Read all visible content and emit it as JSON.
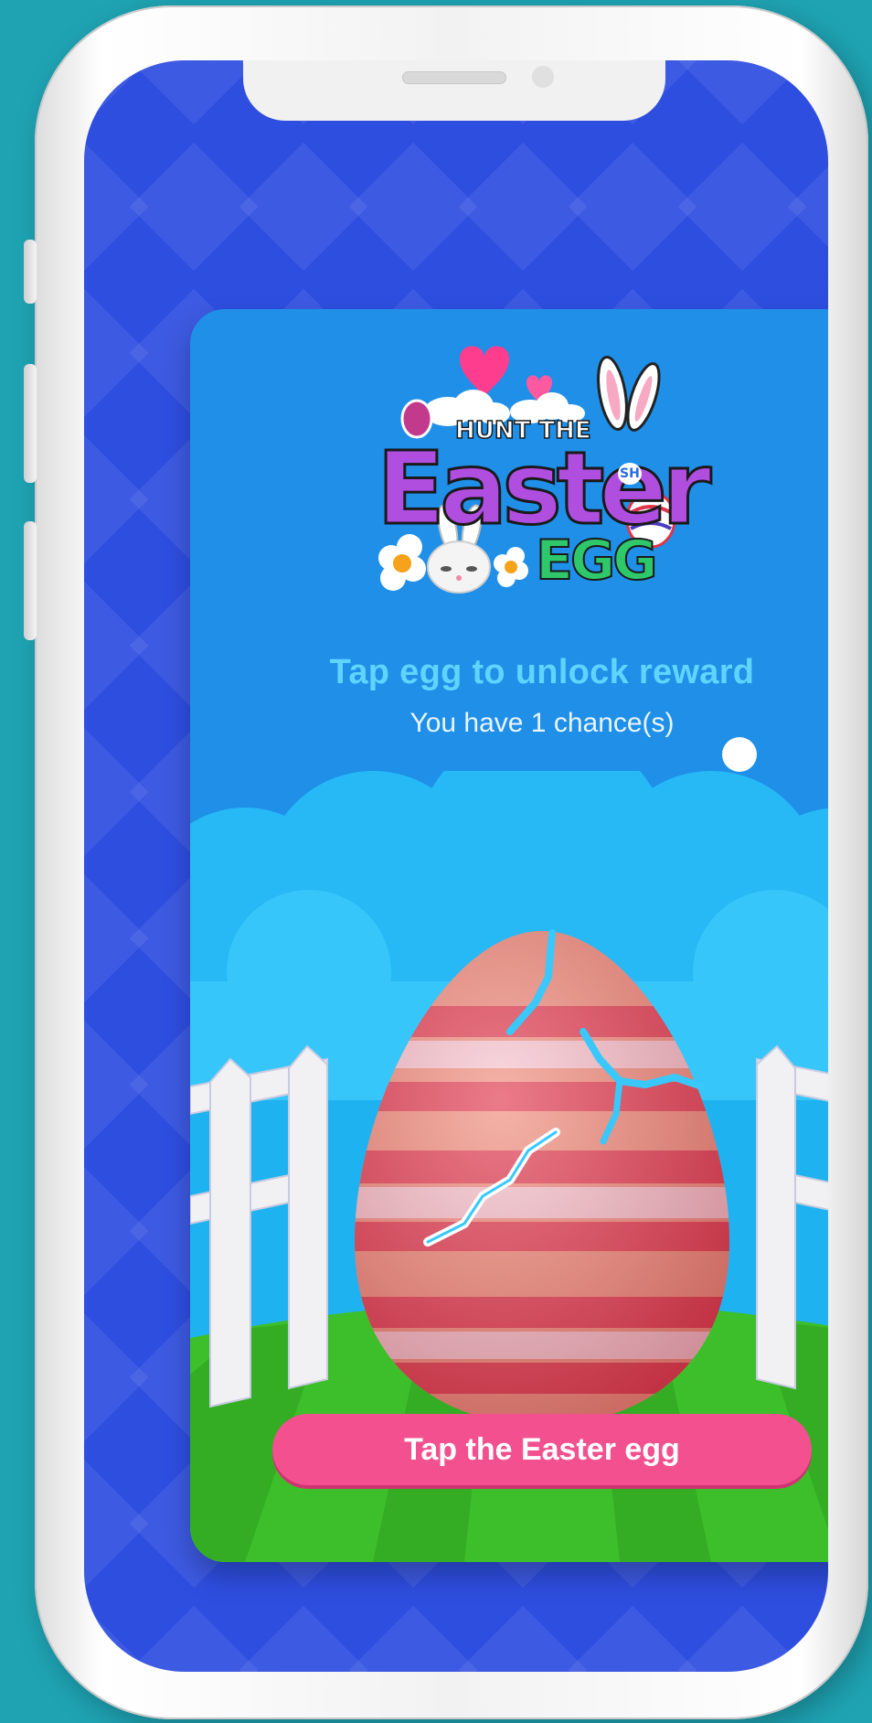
{
  "logo": {
    "hunt_the": "HUNT THE",
    "easter": "Easter",
    "egg": "EGG",
    "badge": "SH"
  },
  "prompt": {
    "title": "Tap egg to unlock reward",
    "chances_text": "You have 1 chance(s)"
  },
  "button": {
    "label": "Tap the Easter egg"
  },
  "colors": {
    "backdrop": "#1fa3b3",
    "screen_bg": "#2e4ee0",
    "card_bg": "#1f8fe8",
    "title_color": "#5fd4ff",
    "button_bg": "#f2508f",
    "grass": "#3cbf2a",
    "egg_base": "#f08a78",
    "egg_stripe_red": "#e0344a",
    "egg_stripe_pink": "#f7c4cf"
  },
  "icons": [
    "heart-icon",
    "cloud-icon",
    "bunny-icon",
    "flower-icon",
    "easter-egg-icon"
  ]
}
